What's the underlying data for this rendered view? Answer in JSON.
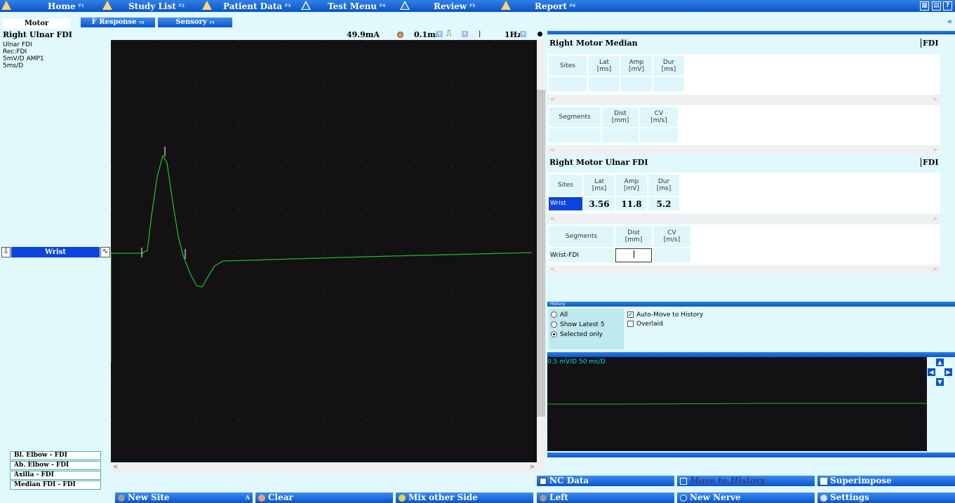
{
  "nav": [
    {
      "label": "Home",
      "fkey": "F1"
    },
    {
      "label": "Study List",
      "fkey": "F2"
    },
    {
      "label": "Patient Data",
      "fkey": "F3"
    },
    {
      "label": "Test Menu",
      "fkey": "F4"
    },
    {
      "label": "Review",
      "fkey": "F5"
    },
    {
      "label": "Report",
      "fkey": "F6"
    }
  ],
  "window_icons": [
    "grid-icon",
    "print-icon",
    "help-icon"
  ],
  "subtabs": {
    "motor": "Motor",
    "fresponse": "F Response",
    "fresponse_key": "F8",
    "sensory": "Sensory",
    "sensory_key": "F9"
  },
  "nerve": {
    "title": "Right Ulnar FDI",
    "line1": "Ulnar FDI",
    "line2": "Rec:FDI",
    "line3": "5mV/D  AMP1",
    "line4": "5ms/D"
  },
  "stim": {
    "current": "49.9mA",
    "duration": "0.1ms",
    "rate": "1Hz",
    "separator": "|"
  },
  "site_label": "Wrist",
  "site_list": [
    "Bl. Elbow - FDI",
    "Ab. Elbow - FDI",
    "Axilla - FDI",
    "Median FDI - FDI"
  ],
  "median": {
    "title": "Right Motor Median",
    "muscle": "FDI",
    "site_headers": [
      "Sites",
      "Lat\n[ms]",
      "Amp\n[mV]",
      "Dur\n[ms]"
    ],
    "seg_headers": [
      "Segments",
      "Dist\n[mm]",
      "CV\n[m/s]"
    ]
  },
  "ulnar": {
    "title": "Right Motor Ulnar FDI",
    "muscle": "FDI",
    "site_headers": [
      "Sites",
      "Lat\n[ms]",
      "Amp\n[mV]",
      "Dur\n[ms]"
    ],
    "row": {
      "site": "Wrist",
      "lat": "3.56",
      "amp": "11.8",
      "dur": "5.2"
    },
    "seg_headers": [
      "Segments",
      "Dist\n[mm]",
      "CV\n[m/s]"
    ],
    "seg_row": {
      "segment": "Wrist-FDI",
      "dist": "",
      "cv": ""
    }
  },
  "history": {
    "title": "History",
    "opt_all": "All",
    "opt_latest": "Show Latest 5",
    "opt_selected": "Selected only",
    "auto_move": "Auto-Move to History",
    "overlaid": "Overlaid"
  },
  "mini_trace_label": "0.5 mV/D 50 ms/D",
  "buttons": {
    "nc_data": "NC Data",
    "move_history": "Move to History",
    "superimpose": "Superimpose",
    "new_site": "New Site",
    "clear": "Clear",
    "mix_side": "Mix other Side",
    "left": "Left",
    "new_nerve": "New Nerve",
    "settings": "Settings"
  },
  "scroll_left": "<",
  "scroll_right": ">"
}
